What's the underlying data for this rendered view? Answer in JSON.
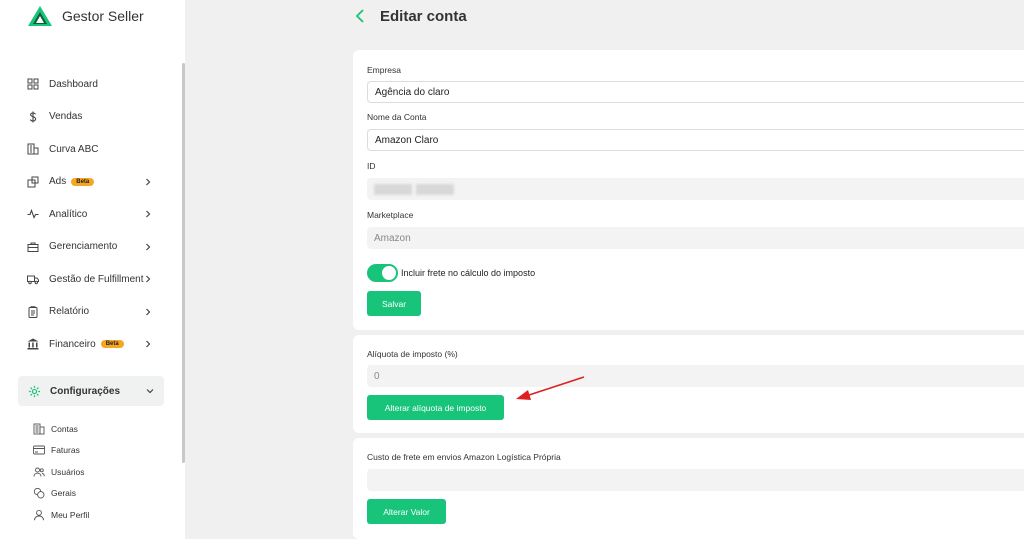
{
  "brand": {
    "name": "Gestor Seller",
    "color": "#17c47a"
  },
  "sidebar": {
    "items": [
      {
        "label": "Dashboard",
        "icon": "grid-icon",
        "badge": "",
        "chevron": false
      },
      {
        "label": "Vendas",
        "icon": "dollar-icon",
        "badge": "",
        "chevron": false
      },
      {
        "label": "Curva ABC",
        "icon": "building-icon",
        "badge": "",
        "chevron": false
      },
      {
        "label": "Ads",
        "icon": "ads-icon",
        "badge": "Beta",
        "chevron": true
      },
      {
        "label": "Analítico",
        "icon": "pulse-icon",
        "badge": "",
        "chevron": true
      },
      {
        "label": "Gerenciamento",
        "icon": "briefcase-icon",
        "badge": "",
        "chevron": true
      },
      {
        "label": "Gestão de Fulfillment",
        "icon": "truck-icon",
        "badge": "",
        "chevron": true
      },
      {
        "label": "Relatório",
        "icon": "report-icon",
        "badge": "",
        "chevron": true
      },
      {
        "label": "Financeiro",
        "icon": "bank-icon",
        "badge": "Beta",
        "chevron": true
      }
    ],
    "config": {
      "label": "Configurações",
      "icon": "gear-icon"
    },
    "sub_items": [
      {
        "label": "Contas",
        "icon": "accounts-icon"
      },
      {
        "label": "Faturas",
        "icon": "card-icon"
      },
      {
        "label": "Usuários",
        "icon": "users-icon"
      },
      {
        "label": "Gerais",
        "icon": "coins-icon"
      },
      {
        "label": "Meu Perfil",
        "icon": "user-icon"
      }
    ],
    "badge_color": "#f5a623"
  },
  "header": {
    "title": "Editar conta"
  },
  "form": {
    "empresa_label": "Empresa",
    "empresa_value": "Agência do claro",
    "nome_label": "Nome da Conta",
    "nome_value": "Amazon Claro",
    "id_label": "ID",
    "marketplace_label": "Marketplace",
    "marketplace_value": "Amazon",
    "toggle_label": "Incluir frete no cálculo do imposto",
    "toggle_on": true,
    "save_label": "Salvar"
  },
  "tax": {
    "label": "Alíquota de imposto (%)",
    "value": "0",
    "button_label": "Alterar alíquota de imposto"
  },
  "shipping": {
    "label": "Custo de frete em envios Amazon Logística Própria",
    "value": "",
    "button_label": "Alterar Valor"
  },
  "annotation_color": "#e02020"
}
